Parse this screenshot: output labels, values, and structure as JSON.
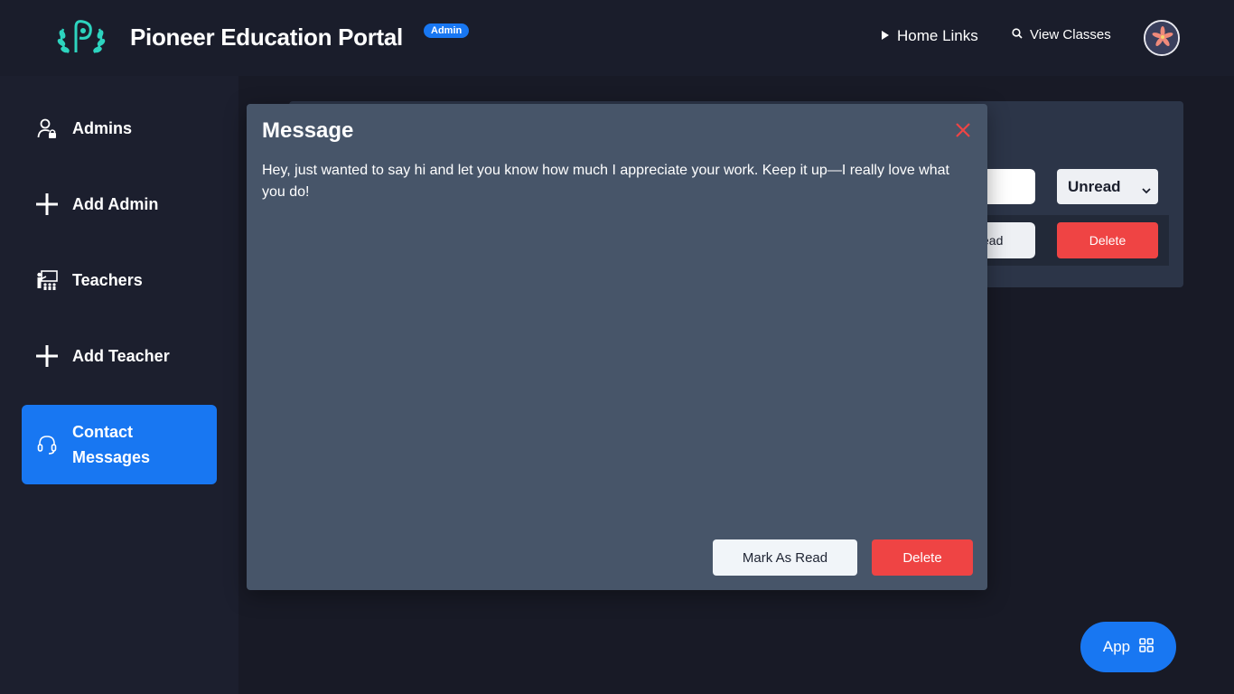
{
  "header": {
    "title": "Pioneer Education Portal",
    "badge": "Admin",
    "nav": [
      {
        "label": "Home Links",
        "icon": "play-triangle-icon"
      },
      {
        "label": "View Classes",
        "icon": "search-icon"
      }
    ]
  },
  "sidebar": {
    "items": [
      {
        "label": "Admins",
        "icon": "user-lock-icon"
      },
      {
        "label": "Add Admin",
        "icon": "plus-icon"
      },
      {
        "label": "Teachers",
        "icon": "teacher-board-icon"
      },
      {
        "label": "Add Teacher",
        "icon": "plus-icon"
      },
      {
        "label": "Contact Messages",
        "icon": "headset-icon",
        "active": true
      }
    ]
  },
  "background_panel": {
    "filter_value": "Unread",
    "read_button_partial": "ead",
    "delete_label": "Delete"
  },
  "modal": {
    "title": "Message",
    "body": "Hey, just wanted to say hi and let you know how much I appreciate your work. Keep it up—I really love what you do!",
    "mark_read_label": "Mark As Read",
    "delete_label": "Delete"
  },
  "fab": {
    "label": "App",
    "icon": "grid-icon"
  },
  "colors": {
    "accent": "#1877f2",
    "danger": "#ef4444",
    "modal_bg": "#475569",
    "page_bg": "#181a26",
    "logo": "#2dd4bf"
  }
}
